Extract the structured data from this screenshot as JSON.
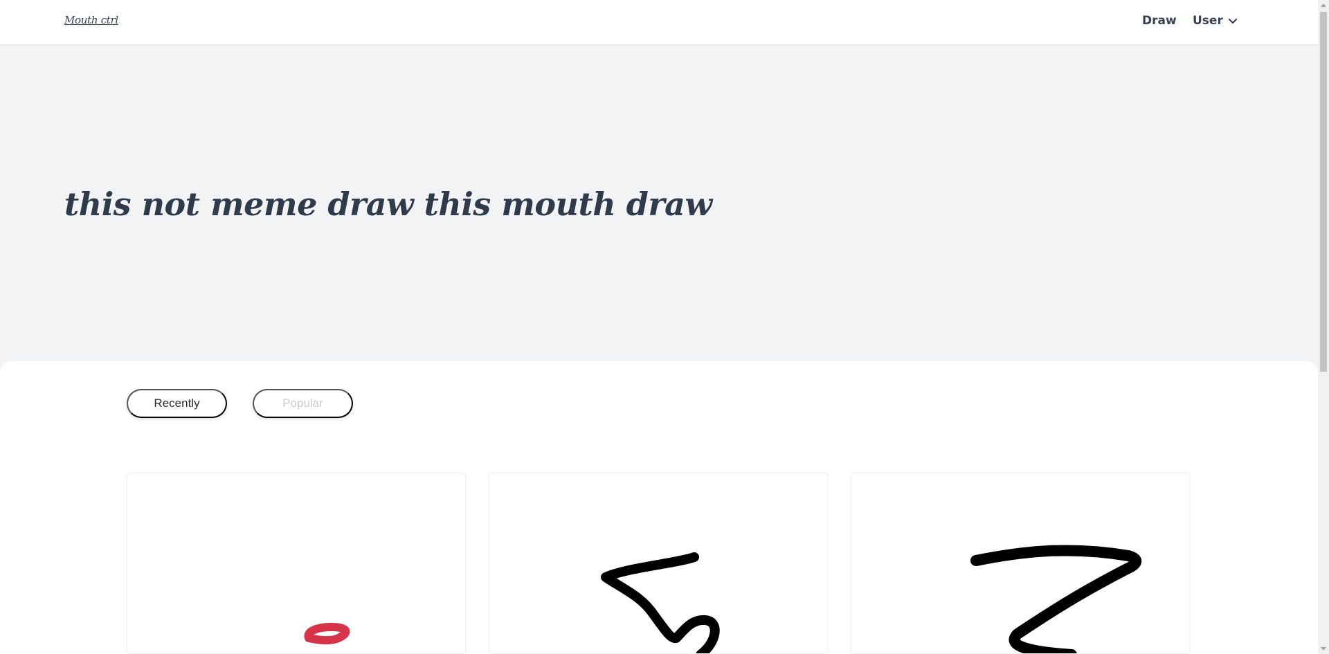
{
  "header": {
    "logo": "Mouth ctrl",
    "nav": {
      "draw": "Draw",
      "user": "User"
    }
  },
  "hero": {
    "title": "this not meme draw this mouth draw"
  },
  "tabs": [
    {
      "label": "Recently",
      "active": true
    },
    {
      "label": "Popular",
      "active": false
    }
  ],
  "colors": {
    "background": "#f2f3f5",
    "text": "#374151",
    "inactive_tab": "#c8ccd2",
    "red_stroke": "#d7344a"
  },
  "icons": {
    "user_menu": "chevron-down-icon"
  }
}
